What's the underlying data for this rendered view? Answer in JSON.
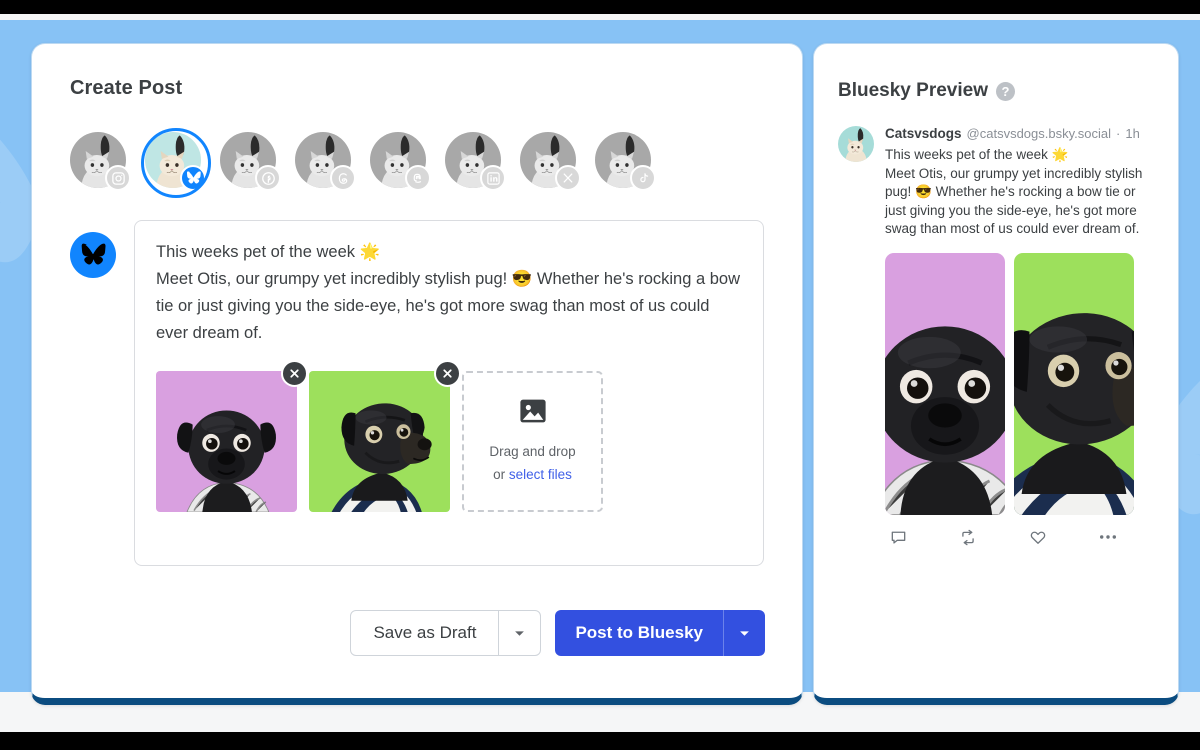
{
  "compose": {
    "title": "Create Post",
    "accounts": [
      {
        "platform": "instagram",
        "icon": "instagram-icon",
        "selected": false
      },
      {
        "platform": "bluesky",
        "icon": "bluesky-butterfly-icon",
        "selected": true
      },
      {
        "platform": "facebook",
        "icon": "facebook-icon",
        "selected": false
      },
      {
        "platform": "threads",
        "icon": "threads-icon",
        "selected": false
      },
      {
        "platform": "mastodon",
        "icon": "mastodon-icon",
        "selected": false
      },
      {
        "platform": "linkedin",
        "icon": "linkedin-icon",
        "selected": false
      },
      {
        "platform": "x",
        "icon": "x-icon",
        "selected": false
      },
      {
        "platform": "tiktok",
        "icon": "tiktok-icon",
        "selected": false
      }
    ],
    "composer_logo_icon": "bluesky-butterfly-icon",
    "post_text": "This weeks pet of the week 🌟\nMeet Otis, our grumpy yet incredibly stylish pug! 😎 Whether he's rocking a bow tie or just giving you the side-eye, he's got more swag than most of us could ever dream of.",
    "media": [
      {
        "alt": "black pug on purple background",
        "bg": "#d9a0e0",
        "remove_icon": "close-icon"
      },
      {
        "alt": "black pug on green background",
        "bg": "#9de05c",
        "remove_icon": "close-icon"
      }
    ],
    "dropzone": {
      "icon": "image-placeholder-icon",
      "line1": "Drag and drop",
      "line2_prefix": "or ",
      "line2_link": "select files"
    },
    "buttons": {
      "draft_label": "Save as Draft",
      "draft_caret_icon": "chevron-down-icon",
      "post_label": "Post to Bluesky",
      "post_caret_icon": "chevron-down-icon"
    }
  },
  "preview": {
    "title": "Bluesky Preview",
    "help_icon": "help-circle-icon",
    "help_glyph": "?",
    "author_name": "Catsvsdogs",
    "author_handle": "@catsvsdogs.bsky.social",
    "separator": "·",
    "timestamp": "1h",
    "avatar_alt": "cat profile photo",
    "post_text": "This weeks pet of the week 🌟\nMeet Otis, our grumpy yet incredibly stylish pug! 😎 Whether he's rocking a bow tie or just giving you the side-eye, he's got more swag than most of us could ever dream of.",
    "media": [
      {
        "alt": "black pug on purple background",
        "bg": "#d9a0e0"
      },
      {
        "alt": "black pug on green background",
        "bg": "#9de05c"
      }
    ],
    "actions": [
      {
        "name": "reply-icon",
        "label": "Reply"
      },
      {
        "name": "repost-icon",
        "label": "Repost"
      },
      {
        "name": "like-icon",
        "label": "Like"
      },
      {
        "name": "more-options-icon",
        "label": "More"
      }
    ]
  },
  "colors": {
    "backdrop_blue": "#87c2f5",
    "bluesky_blue": "#1185fe",
    "post_button_blue": "#3350e0",
    "card_bottom_navy": "#0b4c80",
    "link_blue": "#4060e8",
    "media_purple": "#d9a0e0",
    "media_green": "#9de05c"
  }
}
